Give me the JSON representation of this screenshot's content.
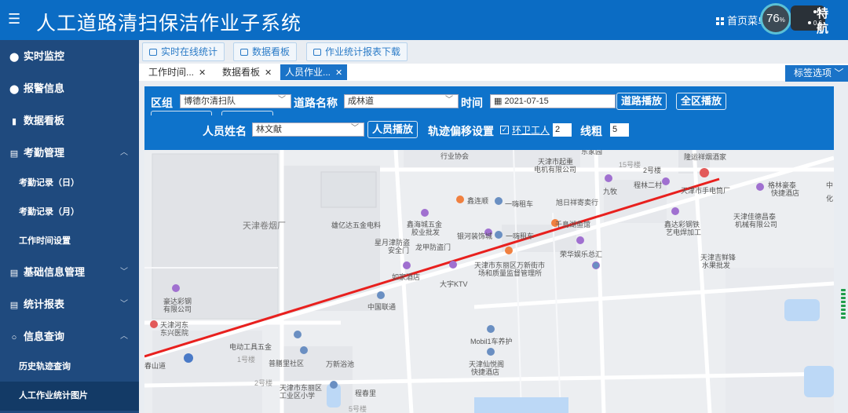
{
  "header": {
    "menu_icon": "hamburger-icon",
    "title": "人工道路清扫保洁作业子系统",
    "home_menu": "首页菜单",
    "perf_gauge": "76",
    "perf_unit": "%",
    "net_up": "1",
    "net_down": "0.6",
    "user_line1": "特",
    "user_line2": "航"
  },
  "sidebar": {
    "items": [
      {
        "label": "实时监控",
        "icon": "location-pin-icon"
      },
      {
        "label": "报警信息",
        "icon": "location-pin-icon"
      },
      {
        "label": "数据看板",
        "icon": "bar-chart-icon"
      },
      {
        "label": "考勤管理",
        "icon": "document-icon"
      },
      {
        "label": "考勤记录（日）"
      },
      {
        "label": "考勤记录（月）"
      },
      {
        "label": "工作时间设置"
      },
      {
        "label": "基础信息管理",
        "icon": "document-icon"
      },
      {
        "label": "统计报表",
        "icon": "document-icon"
      },
      {
        "label": "信息查询",
        "icon": "search-icon"
      },
      {
        "label": "历史轨迹查询"
      },
      {
        "label": "人工作业统计图片"
      }
    ]
  },
  "toolbar": {
    "buttons": [
      "实时在线统计",
      "数据看板",
      "作业统计报表下载"
    ]
  },
  "tabs": {
    "items": [
      "工作时间...",
      "数据看板",
      "人员作业..."
    ],
    "tag_options": "标签选项"
  },
  "filters": {
    "group_label": "区组",
    "group_value": "博德尔清扫队",
    "road_label": "道路名称",
    "road_value": "成林道",
    "time_label": "时间",
    "time_value": "2021-07-15",
    "road_play": "道路播放",
    "all_play": "全区播放",
    "person_label": "人员姓名",
    "person_value": "林文献",
    "person_play": "人员播放",
    "offset_label": "轨迹偏移设置",
    "offset_check_label": "环卫工人",
    "offset_value": "2",
    "line_label": "线粗",
    "line_value": "5"
  },
  "map": {
    "labels": [
      "行业协会",
      "天津市起重",
      "电机有限公司",
      "东家园",
      "隆运祥烟酒家",
      "2号楼",
      "15号楼",
      "九牧",
      "程林二村",
      "天津市手电筒厂",
      "格林豪泰",
      "快捷酒店",
      "鑫连顺",
      "一嗨租车",
      "旭日祥寄卖行",
      "天津卷烟厂",
      "雄亿达五金电料",
      "鑫海城五金",
      "胶业批发",
      "银河装饰城",
      "一嗨租车",
      "千島湖鱼馆",
      "鑫达彩钢铁",
      "艺电焊加工",
      "天津佳德昌泰",
      "机械有限公司",
      "星月津防盗",
      "安全门",
      "龙甲防盗门",
      "荣华娱乐总汇",
      "天津吉鲜锋",
      "水果批发",
      "天津市东丽区万新街市",
      "场和质量监督管理所",
      "如家酒店",
      "大宇KTV",
      "中国联通",
      "豪达彩钢",
      "有限公司",
      "天津河东",
      "东兴医院",
      "电动工具五金",
      "Mobil1车养护",
      "1号楼",
      "普膳里社区",
      "万新浴池",
      "天津仙悦阁",
      "快捷酒店",
      "2号楼",
      "天津市东丽区",
      "工业区小学",
      "程春里",
      "春山道",
      "5号楼",
      "中",
      "化"
    ]
  },
  "colors": {
    "topbar": "#0b6cc4",
    "sidebar": "#1f4a7e",
    "panel": "#0e73cb",
    "track": "#e8201e"
  }
}
